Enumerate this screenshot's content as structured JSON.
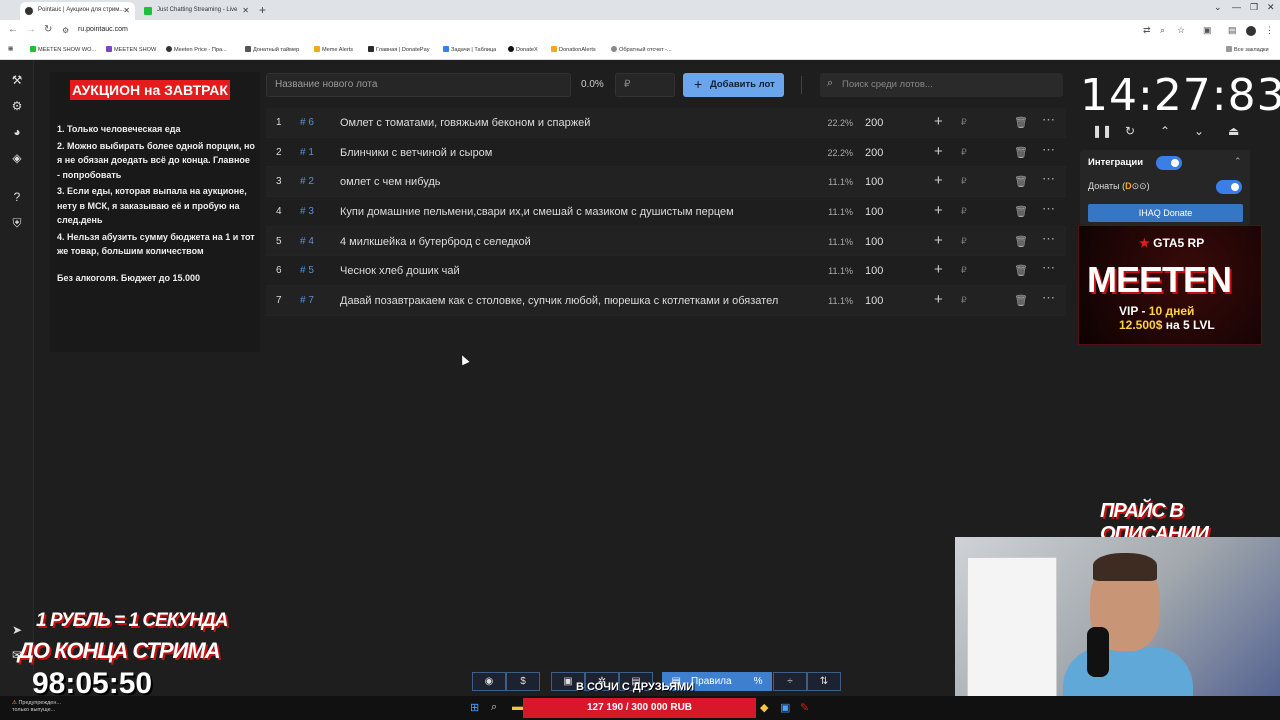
{
  "browser": {
    "tabs": [
      {
        "label": "Pointauc | Аукцион для стрим..."
      },
      {
        "label": "Just Chatting Streaming - Live"
      }
    ],
    "url": "ru.pointauc.com",
    "bookmarks": [
      "MEETEN SHOW WO...",
      "MEETEN SHOW",
      "Meeten Price - Пра...",
      "Донатный таймер",
      "Meme Alerts",
      "Главная | DonatePay",
      "Задачи | Таблица",
      "DonateX",
      "DonationAlerts",
      "Обратный отсчет -..."
    ],
    "all_bookmarks": "Все закладки"
  },
  "rules": {
    "title": "АУКЦИОН на ЗАВТРАК",
    "items": [
      "1. Только человеческая еда",
      "2. Можно выбирать более одной порции, но я не обязан доедать всё до конца. Главное - попробовать",
      "3. Если еды, которая выпала на аукционе, нету в МСК, я заказываю её и пробую на след.день",
      "4. Нельзя абузить сумму бюджета на 1 и тот же товар, большим количеством"
    ],
    "budget": "Без алкоголя. Бюджет до 15.000"
  },
  "toolbar": {
    "new_lot_placeholder": "Название нового лота",
    "percent": "0.0%",
    "currency": "₽",
    "add_label": "Добавить лот",
    "search_placeholder": "Поиск среди лотов..."
  },
  "lots": [
    {
      "num": "1",
      "id": "# 6",
      "name": "Омлет с томатами, говяжьим беконом и спаржей",
      "percent": "22.2%",
      "amount": "200"
    },
    {
      "num": "2",
      "id": "# 1",
      "name": "Блинчики с ветчиной и сыром",
      "percent": "22.2%",
      "amount": "200"
    },
    {
      "num": "3",
      "id": "# 2",
      "name": "омлет с чем нибудь",
      "percent": "11.1%",
      "amount": "100"
    },
    {
      "num": "4",
      "id": "# 3",
      "name": "Купи домашние пельмени,свари их,и смешай с мазиком с душистым перцем",
      "percent": "11.1%",
      "amount": "100"
    },
    {
      "num": "5",
      "id": "# 4",
      "name": "4 милкшейка и бутерброд с селедкой",
      "percent": "11.1%",
      "amount": "100"
    },
    {
      "num": "6",
      "id": "# 5",
      "name": "Чеснок хлеб дошик чай",
      "percent": "11.1%",
      "amount": "100"
    },
    {
      "num": "7",
      "id": "# 7",
      "name": "Давай позавтракаем как с столовке, супчик любой, пюрешка с котлетками и обязател",
      "percent": "11.1%",
      "amount": "100"
    }
  ],
  "timer": {
    "value": "14:27:83"
  },
  "integrations": {
    "label": "Интеграции",
    "donations": "Донаты (",
    "donate_button": "IHAQ Donate"
  },
  "promo": {
    "game": "GTA5 RP",
    "brand": "MEETEN",
    "vip_a": "VIP - ",
    "vip_b": "10 дней",
    "vip_c": "12.500$",
    "vip_d": " на 5 LVL"
  },
  "overlay": {
    "price": "ПРАЙС В ОПИСАНИИ",
    "line1": "1 РУБЛЬ = 1 СЕКУНДА",
    "line2": "ДО КОНЦА СТРИМА",
    "countdown": "98:05:50"
  },
  "bottom": {
    "rules_label": "Правила",
    "percent_icon": "%",
    "caption": "В СОЧИ С ДРУЗЬЯМИ",
    "donations_progress": "127 190 / 300 000 RUB"
  },
  "warning": {
    "line1": "Предупрежден...",
    "line2": "только выпуще..."
  },
  "colors": {
    "accent": "#6ba6ec",
    "brand_red": "#e51b1b",
    "id_blue": "#5b8fd8"
  }
}
